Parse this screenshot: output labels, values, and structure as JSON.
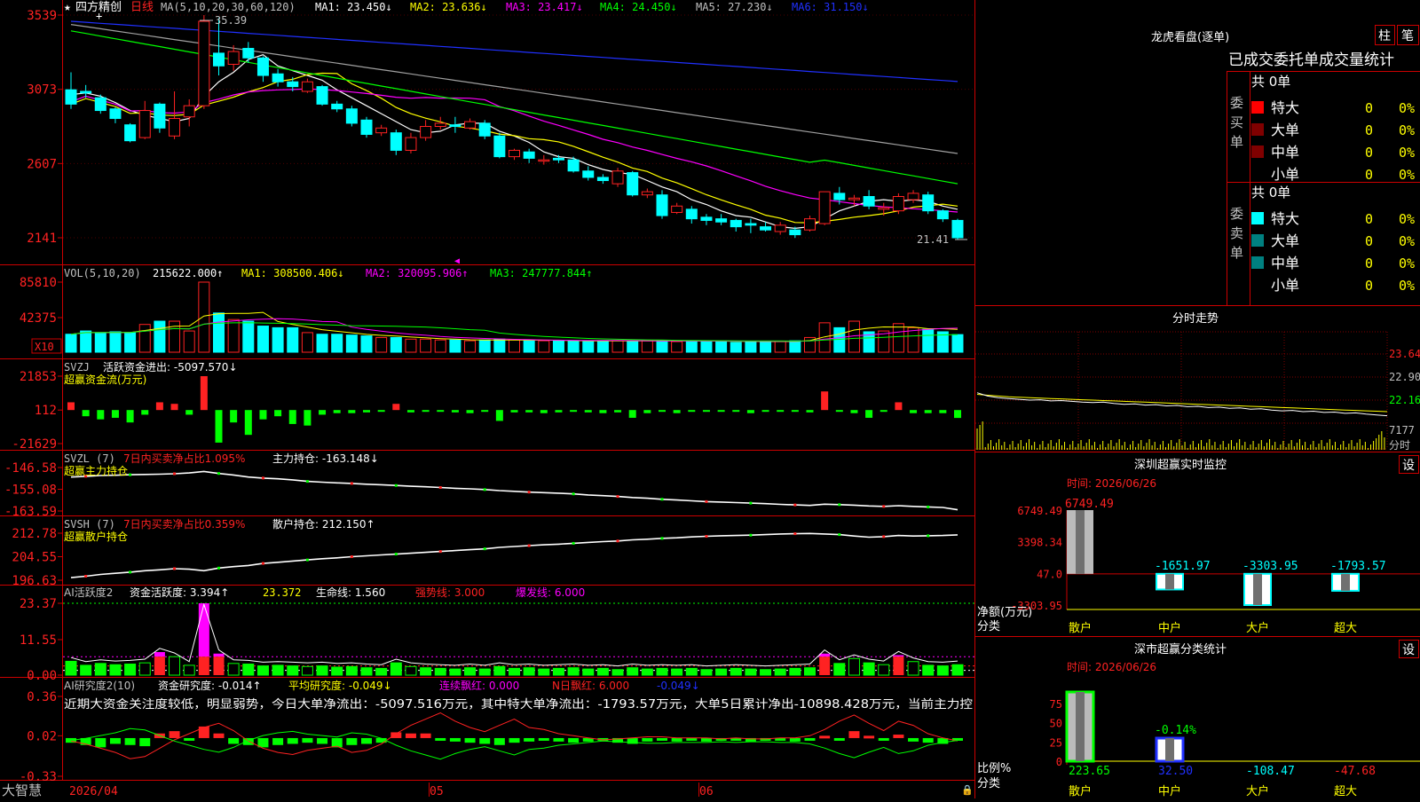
{
  "colors": {
    "up": "#ff2222",
    "down": "#00ffff",
    "ma5": "#ffffff",
    "ma10": "#ffff00",
    "ma20": "#ff00ff",
    "ma30": "#00ff00",
    "ma60": "#a0a0a0",
    "ma120": "#2030ff",
    "axis": "#cc0000",
    "grid": "#800000",
    "green": "#00ff00",
    "magenta": "#ff00ff",
    "yellow": "#ffff00",
    "white": "#ffffff"
  },
  "main": {
    "title": "四方精创",
    "period": "日线",
    "ma_label": "MA(5,10,20,30,60,120)",
    "ma_values": [
      "MA1: 23.450↓",
      "MA2: 23.636↓",
      "MA3: 23.417↓",
      "MA4: 24.450↓",
      "MA5: 27.230↓",
      "MA6: 31.150↓"
    ],
    "price_max_label": "35.39",
    "price_min_label": "21.41",
    "y_ticks": [
      "3539",
      "3073",
      "2607",
      "2141"
    ],
    "tick_values": [
      35.39,
      30.73,
      26.07,
      21.41
    ]
  },
  "vol": {
    "label": "VOL(5,10,20)",
    "value": "215622.000↑",
    "ma1": "MA1: 308500.406↓",
    "ma2": "MA2: 320095.906↑",
    "ma3": "MA3: 247777.844↑",
    "y_ticks": [
      "85810",
      "42375"
    ],
    "unit": "X10"
  },
  "svzj": {
    "label": "SVZJ",
    "name": "活跃资金进出: -5097.570↓",
    "title": "超赢资金流(万元)",
    "y_ticks": [
      "21853",
      "112",
      "-21629"
    ]
  },
  "svzl": {
    "label": "SVZL (7)",
    "desc": "7日内买卖净占比1.095%",
    "value": "主力持仓: -163.148↓",
    "title": "超赢主力持仓",
    "y_ticks": [
      "-146.58",
      "-155.08",
      "-163.59"
    ]
  },
  "svsh": {
    "label": "SVSH (7)",
    "desc": "7日内买卖净占比0.359%",
    "value": "散户持仓: 212.150↑",
    "title": "超赢散户持仓",
    "y_ticks": [
      "212.78",
      "204.55",
      "196.63"
    ]
  },
  "ai1": {
    "label": "AI活跃度2",
    "v1": "资金活跃度: 3.394↑",
    "v2": "23.372",
    "v3": "生命线: 1.560",
    "v4": "强势线: 3.000",
    "v5": "爆发线: 6.000",
    "y_ticks": [
      "23.37",
      "11.55",
      "0.00"
    ]
  },
  "ai2": {
    "label": "AI研究度2(10)",
    "v1": "资金研究度: -0.014↑",
    "v2": "平均研究度: -0.049↓",
    "v3": "连续飘红: 0.000",
    "v4": "N日飘红: 6.000",
    "v5": "-0.049↓",
    "text": "近期大资金关注度较低，明显弱势，今日大单净流出：-5097.516万元，其中特大单净流出：-1793.57万元，大单5日累计净出-10898.428万元，当前主力控",
    "y_ticks": [
      "0.36",
      "0.02",
      "-0.33"
    ]
  },
  "xaxis": {
    "labels": [
      "2026/04",
      "05",
      "06"
    ],
    "brand": "大智慧"
  },
  "right": {
    "lh_title": "龙虎看盘(逐单)",
    "btn1": "柱",
    "btn2": "笔",
    "stat_title": "已成交委托单成交量统计",
    "buy_side": "委买单",
    "sell_side": "委卖单",
    "total_buy": "共 0单",
    "total_sell": "共 0单",
    "rows": [
      "特大",
      "大单",
      "中单",
      "小单"
    ],
    "row_value": "0",
    "row_pct": "0%",
    "buy_colors": [
      "#ff0000",
      "#800000",
      "#800000",
      "#000000"
    ],
    "sell_colors": [
      "#00ffff",
      "#008080",
      "#008080",
      "#000000"
    ],
    "fs_title": "分时走势",
    "fs_y": [
      "23.64",
      "22.90",
      "22.16"
    ],
    "fs_vol": "7177",
    "fs_unit": "分时",
    "mon_title": "深圳超赢实时监控",
    "mon_time": "时间: 2026/06/26",
    "mon_y": [
      "6749.49",
      "3398.34",
      "47.0",
      "-3303.95"
    ],
    "mon_values": [
      "6749.49",
      "-1651.97",
      "-3303.95",
      "-1793.57"
    ],
    "mon_ylabel": "净额(万元)",
    "mon_xlabel": "分类",
    "cls_title": "深市超赢分类统计",
    "cls_time": "时间: 2026/06/26",
    "cls_y": [
      "75",
      "50",
      "25",
      "0"
    ],
    "cls_values": [
      "223.65",
      "32.50",
      "-108.47",
      "-47.68"
    ],
    "cls_pct": "-0.14%",
    "cls_ylabel": "比例%",
    "cls_xlabel": "分类",
    "categories": [
      "散户",
      "中户",
      "大户",
      "超大"
    ],
    "settings": "设"
  },
  "chart_data": [
    {
      "type": "candlestick",
      "title": "四方精创 日线",
      "ylim": [
        21.41,
        35.39
      ],
      "candles": [
        [
          30.7,
          29.8,
          31.8,
          29.5
        ],
        [
          30.6,
          30.5,
          31.0,
          30.2
        ],
        [
          30.2,
          29.4,
          30.4,
          29.2
        ],
        [
          29.5,
          28.9,
          29.6,
          28.6
        ],
        [
          28.5,
          27.5,
          28.6,
          27.4
        ],
        [
          27.7,
          29.4,
          30.0,
          27.6
        ],
        [
          29.8,
          28.3,
          29.9,
          28.0
        ],
        [
          27.8,
          28.9,
          30.6,
          27.6
        ],
        [
          29.0,
          29.7,
          30.1,
          28.4
        ],
        [
          29.7,
          35.0,
          35.39,
          29.5
        ],
        [
          33.0,
          32.2,
          35.2,
          31.6
        ],
        [
          32.3,
          33.1,
          33.5,
          31.9
        ],
        [
          33.3,
          32.7,
          33.7,
          32.4
        ],
        [
          32.7,
          31.6,
          32.8,
          31.2
        ],
        [
          31.7,
          31.2,
          32.0,
          30.9
        ],
        [
          31.2,
          30.9,
          31.5,
          30.6
        ],
        [
          30.6,
          31.2,
          31.4,
          30.5
        ],
        [
          30.9,
          29.8,
          31.0,
          29.7
        ],
        [
          29.8,
          29.5,
          30.0,
          29.3
        ],
        [
          29.5,
          28.6,
          29.7,
          28.4
        ],
        [
          28.8,
          27.9,
          29.0,
          27.7
        ],
        [
          28.0,
          28.3,
          28.5,
          27.8
        ],
        [
          28.0,
          26.9,
          28.2,
          26.6
        ],
        [
          26.9,
          27.7,
          28.0,
          26.7
        ],
        [
          27.7,
          28.4,
          28.8,
          27.5
        ],
        [
          28.4,
          28.6,
          29.0,
          28.2
        ],
        [
          28.5,
          28.4,
          29.0,
          28.0
        ],
        [
          28.3,
          28.7,
          28.9,
          28.2
        ],
        [
          28.6,
          27.8,
          28.8,
          27.6
        ],
        [
          27.8,
          26.5,
          28.0,
          26.4
        ],
        [
          26.5,
          26.9,
          27.0,
          26.3
        ],
        [
          26.8,
          26.4,
          27.0,
          26.1
        ],
        [
          26.3,
          26.3,
          26.6,
          26.0
        ],
        [
          26.4,
          26.3,
          26.6,
          26.1
        ],
        [
          26.3,
          25.6,
          26.5,
          25.5
        ],
        [
          25.6,
          25.2,
          25.9,
          25.0
        ],
        [
          25.2,
          25.0,
          25.4,
          24.8
        ],
        [
          24.8,
          25.6,
          25.8,
          24.6
        ],
        [
          25.5,
          24.1,
          25.6,
          24.0
        ],
        [
          24.1,
          24.3,
          24.5,
          23.9
        ],
        [
          24.1,
          22.8,
          24.4,
          22.6
        ],
        [
          23.0,
          23.4,
          23.6,
          22.9
        ],
        [
          23.2,
          22.6,
          23.4,
          22.3
        ],
        [
          22.7,
          22.5,
          22.9,
          22.2
        ],
        [
          22.6,
          22.4,
          22.9,
          22.2
        ],
        [
          22.5,
          22.1,
          22.6,
          21.8
        ],
        [
          22.3,
          22.2,
          22.6,
          21.7
        ],
        [
          22.1,
          21.9,
          22.4,
          21.8
        ],
        [
          21.8,
          22.2,
          22.4,
          21.6
        ],
        [
          21.9,
          21.6,
          22.1,
          21.4
        ],
        [
          21.9,
          22.6,
          22.8,
          21.8
        ],
        [
          22.3,
          24.3,
          24.3,
          22.2
        ],
        [
          24.2,
          23.8,
          24.6,
          23.5
        ],
        [
          23.8,
          23.9,
          24.1,
          23.4
        ],
        [
          24.0,
          23.4,
          24.4,
          23.2
        ],
        [
          23.2,
          23.3,
          23.6,
          22.8
        ],
        [
          23.1,
          24.0,
          24.2,
          22.9
        ],
        [
          23.8,
          24.2,
          24.4,
          23.6
        ],
        [
          24.1,
          23.1,
          24.3,
          22.9
        ],
        [
          23.1,
          22.6,
          23.2,
          22.4
        ],
        [
          22.5,
          21.41,
          22.6,
          21.3
        ]
      ],
      "ma5": [
        30.4,
        30.5,
        30.3,
        29.9,
        29.4,
        29.1,
        28.9,
        28.7,
        28.9,
        30.3,
        31.2,
        31.8,
        32.6,
        32.9,
        32.2,
        31.9,
        31.6,
        31.3,
        30.7,
        30.2,
        29.7,
        29.2,
        28.7,
        28.2,
        28.0,
        28.1,
        28.5,
        28.6,
        28.6,
        28.1,
        27.8,
        27.4,
        26.8,
        26.5,
        26.4,
        26.0,
        25.7,
        25.5,
        25.4,
        25.0,
        24.6,
        24.3,
        23.8,
        23.5,
        23.1,
        22.8,
        22.7,
        22.4,
        22.1,
        22.0,
        22.1,
        22.6,
        23.1,
        23.4,
        23.7,
        23.8,
        23.7,
        23.8,
        23.7,
        23.4,
        23.2
      ]
    },
    {
      "type": "bar",
      "title": "VOL(5,10,20)",
      "unit": "X10",
      "ylim": [
        0,
        85810
      ],
      "values": [
        22000,
        26000,
        24000,
        25000,
        24000,
        34000,
        38000,
        38000,
        26000,
        85810,
        48000,
        40000,
        38000,
        32000,
        30000,
        30000,
        24000,
        22000,
        22000,
        21000,
        20000,
        18000,
        18000,
        16000,
        16000,
        15000,
        15000,
        14000,
        15000,
        16000,
        15000,
        14000,
        14000,
        14000,
        14000,
        13000,
        14000,
        14000,
        14000,
        14000,
        14000,
        13000,
        14000,
        13000,
        14000,
        12000,
        13000,
        13000,
        13000,
        14000,
        18000,
        36000,
        30000,
        38000,
        25000,
        26000,
        35000,
        30000,
        28000,
        25000,
        21562
      ]
    },
    {
      "type": "bar",
      "title": "超赢资金流(万元)",
      "ylim": [
        -21629,
        21853
      ],
      "values": [
        5000,
        -4000,
        -6000,
        -5000,
        -8000,
        -3000,
        5000,
        4000,
        -3000,
        21853,
        -21000,
        -8000,
        -16000,
        -6000,
        -4000,
        -9000,
        -10000,
        -3000,
        -2000,
        -2000,
        -1500,
        -1000,
        4000,
        -1500,
        -1000,
        -1000,
        -1500,
        -2000,
        -1000,
        -7000,
        -1500,
        -1500,
        -2000,
        -1500,
        -1000,
        -1500,
        -2000,
        -1500,
        -5000,
        -2000,
        -1000,
        -2000,
        -1000,
        -1000,
        -500,
        -1000,
        -2000,
        -1000,
        -800,
        -1000,
        -1500,
        12000,
        -1000,
        -2000,
        -5000,
        -1000,
        5000,
        -2000,
        -2000,
        -2000,
        -5097
      ]
    },
    {
      "type": "line",
      "title": "超赢主力持仓",
      "ylim": [
        -163.59,
        -146.58
      ],
      "values": [
        -150.3,
        -150.0,
        -149.7,
        -149.6,
        -149.4,
        -149.3,
        -149.2,
        -149.0,
        -148.7,
        -148.1,
        -148.9,
        -149.5,
        -150.3,
        -150.7,
        -151.0,
        -151.4,
        -152.0,
        -152.3,
        -152.6,
        -152.8,
        -153.1,
        -153.3,
        -153.6,
        -153.9,
        -154.1,
        -154.4,
        -154.7,
        -154.9,
        -155.2,
        -155.6,
        -155.9,
        -156.2,
        -156.4,
        -156.6,
        -156.9,
        -157.3,
        -157.6,
        -157.9,
        -158.3,
        -158.6,
        -159.0,
        -159.3,
        -159.6,
        -159.9,
        -160.1,
        -160.3,
        -160.5,
        -160.7,
        -161.0,
        -161.2,
        -161.4,
        -160.9,
        -161.1,
        -161.3,
        -161.6,
        -161.8,
        -161.5,
        -161.8,
        -162.0,
        -162.2,
        -163.1
      ]
    },
    {
      "type": "line",
      "title": "超赢散户持仓",
      "ylim": [
        196.63,
        212.78
      ],
      "values": [
        197.5,
        198.0,
        198.6,
        199.0,
        199.4,
        199.9,
        200.2,
        200.6,
        200.4,
        199.9,
        200.8,
        201.3,
        201.7,
        202.4,
        202.8,
        203.2,
        203.6,
        204.0,
        204.3,
        204.7,
        205.0,
        205.3,
        205.6,
        205.9,
        206.2,
        206.5,
        206.8,
        207.1,
        207.4,
        207.9,
        208.2,
        208.5,
        208.8,
        209.0,
        209.3,
        209.6,
        209.9,
        210.1,
        210.5,
        210.7,
        211.0,
        211.2,
        211.5,
        211.7,
        211.9,
        212.0,
        212.1,
        212.3,
        212.5,
        212.6,
        212.7,
        212.5,
        212.3,
        211.8,
        211.4,
        211.6,
        212.0,
        211.8,
        211.9,
        212.0,
        212.2
      ]
    },
    {
      "type": "bar",
      "title": "AI活跃度2",
      "ylim": [
        0,
        23.37
      ],
      "values": [
        4.5,
        3.2,
        3.8,
        3.4,
        3.6,
        4.0,
        7.5,
        6.0,
        3.2,
        23.37,
        7.0,
        3.8,
        3.6,
        3.0,
        3.2,
        3.0,
        2.8,
        3.0,
        2.6,
        2.8,
        2.4,
        2.2,
        4.0,
        2.8,
        2.4,
        2.2,
        2.0,
        2.4,
        2.0,
        2.8,
        2.2,
        2.4,
        2.0,
        2.2,
        2.4,
        2.0,
        2.2,
        1.8,
        2.4,
        2.0,
        2.2,
        2.0,
        2.2,
        1.8,
        2.0,
        2.2,
        2.0,
        1.8,
        2.0,
        2.2,
        2.4,
        7.0,
        3.8,
        5.4,
        4.0,
        3.4,
        6.5,
        4.4,
        3.2,
        3.0,
        3.394
      ],
      "life": 1.56,
      "strong": 3.0,
      "burst": 6.0
    },
    {
      "type": "bar",
      "title": "AI研究度2(10)",
      "ylim": [
        -0.33,
        0.36
      ],
      "values": [
        -0.04,
        -0.06,
        -0.08,
        -0.05,
        -0.06,
        -0.07,
        0.04,
        0.06,
        -0.02,
        0.1,
        0.04,
        -0.05,
        -0.06,
        -0.08,
        -0.06,
        -0.05,
        -0.04,
        -0.05,
        -0.08,
        -0.06,
        -0.05,
        -0.04,
        0.05,
        0.04,
        0.04,
        -0.02,
        -0.03,
        -0.04,
        -0.05,
        -0.06,
        -0.04,
        -0.03,
        -0.02,
        -0.03,
        -0.04,
        -0.03,
        -0.02,
        -0.04,
        -0.05,
        -0.03,
        -0.02,
        -0.03,
        -0.02,
        -0.03,
        -0.02,
        -0.02,
        -0.03,
        -0.02,
        -0.02,
        -0.03,
        -0.02,
        0.02,
        -0.02,
        0.06,
        0.02,
        -0.02,
        0.03,
        -0.03,
        -0.04,
        -0.05,
        -0.014
      ],
      "avg": [
        -0.05,
        -0.08,
        -0.12,
        -0.16,
        -0.22,
        -0.2,
        -0.12,
        -0.04,
        0.02,
        0.08,
        0.12,
        0.05,
        -0.05,
        -0.12,
        -0.16,
        -0.18,
        -0.14,
        -0.12,
        -0.1,
        -0.16,
        -0.14,
        -0.08,
        0.02,
        0.1,
        0.16,
        0.22,
        0.14,
        0.08,
        0.04,
        0.1,
        0.16,
        0.08,
        0.06,
        0.02,
        0.0,
        -0.02,
        -0.04,
        -0.03,
        -0.02,
        -0.01,
        -0.01,
        -0.02,
        -0.02,
        -0.02,
        -0.03,
        -0.02,
        -0.03,
        -0.03,
        -0.02,
        -0.02,
        0.0,
        0.06,
        0.14,
        0.2,
        0.12,
        0.05,
        0.14,
        0.1,
        0.02,
        -0.02,
        -0.049
      ]
    },
    {
      "type": "line",
      "title": "分时走势",
      "ylim": [
        21.42,
        23.64
      ],
      "values": [
        22.16,
        22.08,
        22.04,
        22.02,
        22.0,
        21.98,
        21.99,
        21.96,
        21.97,
        21.95,
        21.93,
        21.92,
        21.93,
        21.9,
        21.88,
        21.89,
        21.86,
        21.87,
        21.84,
        21.85,
        21.82,
        21.83,
        21.8,
        21.81,
        21.78,
        21.79,
        21.76,
        21.77,
        21.74,
        21.72,
        21.73,
        21.7,
        21.71,
        21.68,
        21.69,
        21.66,
        21.67,
        21.64,
        21.62,
        21.6
      ],
      "avg": [
        22.12,
        22.1,
        22.08,
        22.06,
        22.05,
        22.04,
        22.03,
        22.02,
        22.01,
        22.0,
        21.99,
        21.98,
        21.97,
        21.96,
        21.95,
        21.94,
        21.93,
        21.92,
        21.91,
        21.9,
        21.89,
        21.88,
        21.87,
        21.86,
        21.85,
        21.84,
        21.83,
        21.82,
        21.81,
        21.8,
        21.79,
        21.78,
        21.77,
        21.76,
        21.75,
        21.74,
        21.73,
        21.72,
        21.71,
        21.7
      ]
    },
    {
      "type": "bar",
      "title": "深圳超赢实时监控",
      "categories": [
        "散户",
        "中户",
        "大户",
        "超大"
      ],
      "values": [
        6749.49,
        -1651.97,
        -3303.95,
        -1793.57
      ],
      "ylim": [
        -3303.95,
        6749.49
      ]
    },
    {
      "type": "bar",
      "title": "深市超赢分类统计",
      "categories": [
        "散户",
        "中户",
        "大户",
        "超大"
      ],
      "values": [
        223.65,
        32.5,
        -108.47,
        -47.68
      ],
      "ylim": [
        0,
        75
      ]
    }
  ]
}
